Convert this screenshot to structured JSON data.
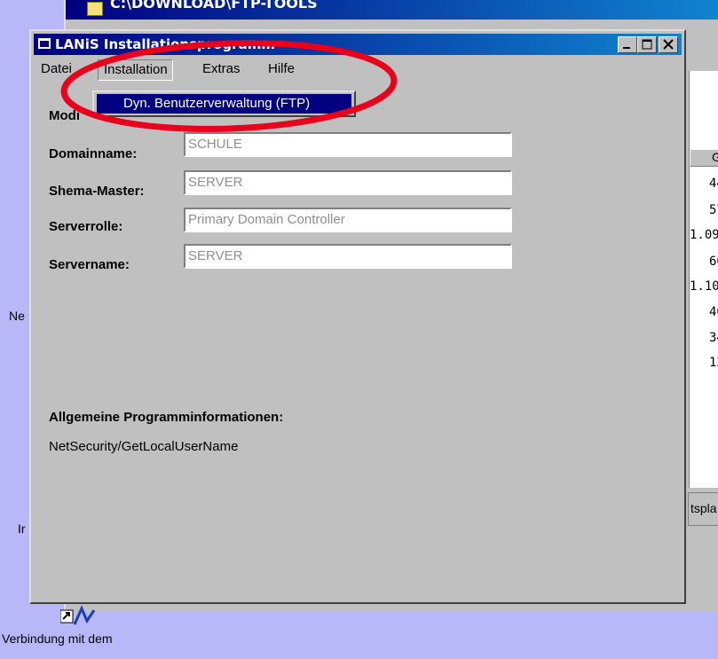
{
  "background_window": {
    "title": "C:\\DOWNLOAD\\FTP-TOOLS",
    "column_header": "G",
    "list_rows": [
      "44",
      "57",
      "1.09",
      "60",
      "1.10",
      "40",
      "34",
      "12"
    ],
    "status_text": "tspla"
  },
  "desktop": {
    "label_ne": "Ne",
    "label_ir": "Ir",
    "shortcut_label": "Verbindung mit dem"
  },
  "window": {
    "title": "LANiS Installationsprogramm",
    "menu": {
      "datei": "Datei",
      "installation": "Installation",
      "extras": "Extras",
      "hilfe": "Hilfe"
    },
    "dropdown_item": "Dyn. Benutzerverwaltung (FTP)",
    "partial_label": "Modi",
    "fields": [
      {
        "label": "Domainname:",
        "value": "SCHULE"
      },
      {
        "label": "Shema-Master:",
        "value": "SERVER"
      },
      {
        "label": "Serverrolle:",
        "value": "Primary Domain Controller"
      },
      {
        "label": "Servername:",
        "value": "SERVER"
      }
    ],
    "info_heading": "Allgemeine Programminformationen:",
    "info_text": "NetSecurity/GetLocalUserName"
  },
  "colors": {
    "desktop": "#b8b8f8",
    "titlebar": "#000080",
    "annotation": "#e8001c",
    "highlight": "#000080"
  }
}
